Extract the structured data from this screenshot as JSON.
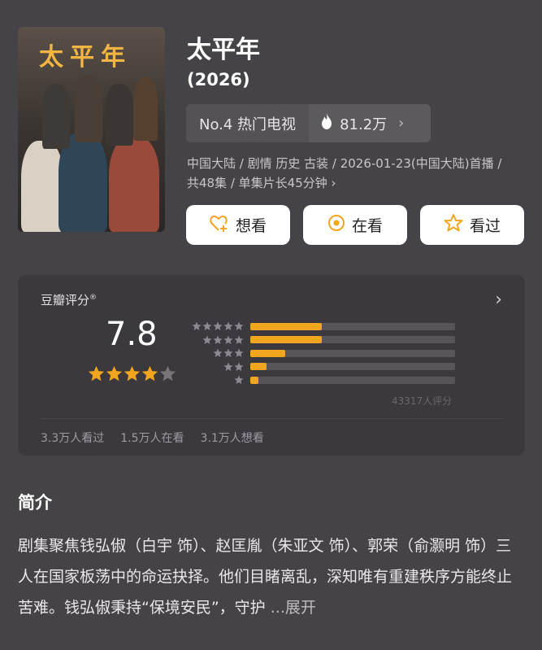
{
  "movie": {
    "poster_title": "太平年",
    "title": "太平年",
    "year": "(2026)",
    "rank_label": "No.4 热门电视",
    "heat": "81.2万",
    "meta": "中国大陆 / 剧情 历史 古装 / 2026-01-23(中国大陆)首播 / 共48集 / 单集片长45分钟"
  },
  "actions": {
    "want": "想看",
    "watching": "在看",
    "watched": "看过"
  },
  "rating": {
    "label": "豆瓣评分",
    "score": "7.8",
    "stars_filled": 4,
    "count": "43317人评分",
    "distribution": [
      {
        "stars": 5,
        "fraction": 0.35
      },
      {
        "stars": 4,
        "fraction": 0.35
      },
      {
        "stars": 3,
        "fraction": 0.17
      },
      {
        "stars": 2,
        "fraction": 0.08
      },
      {
        "stars": 1,
        "fraction": 0.04
      }
    ],
    "stats": {
      "watched": "3.3万人看过",
      "watching": "1.5万人在看",
      "want": "3.1万人想看"
    }
  },
  "intro": {
    "title": "简介",
    "text": "剧集聚焦钱弘俶（白宇 饰）、赵匡胤（朱亚文 饰）、郭荣（俞灏明 饰）三人在国家板荡中的命运抉择。他们目睹离乱，深知唯有重建秩序方能终止苦难。钱弘俶秉持“保境安民”，守护",
    "more": "...展开"
  },
  "colors": {
    "accent": "#f2a51e",
    "background": "#464348"
  }
}
